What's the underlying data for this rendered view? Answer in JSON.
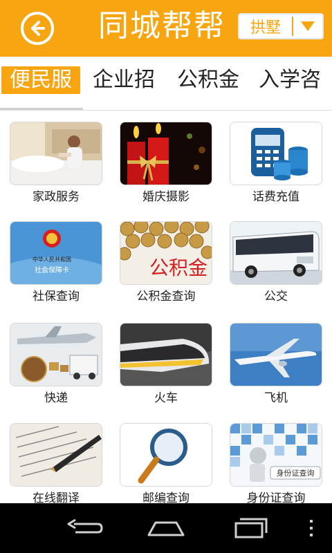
{
  "header": {
    "title": "同城帮帮",
    "city": "拱墅",
    "back_icon": "back-arrow-icon",
    "color": "#f7a511"
  },
  "tabs": [
    {
      "label": "便民服",
      "active": true
    },
    {
      "label": "企业招",
      "active": false
    },
    {
      "label": "公积金",
      "active": false
    },
    {
      "label": "入学咨",
      "active": false
    }
  ],
  "services": [
    {
      "label": "家政服务",
      "image": "housekeeping-image"
    },
    {
      "label": "婚庆摄影",
      "image": "wedding-candles-image"
    },
    {
      "label": "话费充值",
      "image": "phone-recharge-image"
    },
    {
      "label": "社保查询",
      "image": "social-security-card-image"
    },
    {
      "label": "公积金查询",
      "image": "housing-fund-coins-image"
    },
    {
      "label": "公交",
      "image": "bus-image"
    },
    {
      "label": "快递",
      "image": "express-delivery-image"
    },
    {
      "label": "火车",
      "image": "train-image"
    },
    {
      "label": "飞机",
      "image": "airplane-image"
    },
    {
      "label": "在线翻译",
      "image": "translation-pen-image"
    },
    {
      "label": "邮编查询",
      "image": "magnifier-image"
    },
    {
      "label": "身份证查询",
      "image": "id-card-search-image"
    }
  ],
  "image_text": {
    "ssc_line1": "中华人民共和国",
    "ssc_line2": "社会保障卡",
    "fund_text": "公积金",
    "idcard_text": "身份证查询"
  },
  "navbar": {
    "back_icon": "nav-back-icon",
    "home_icon": "nav-home-icon",
    "recents_icon": "nav-recents-icon",
    "menu_icon": "nav-menu-icon"
  }
}
